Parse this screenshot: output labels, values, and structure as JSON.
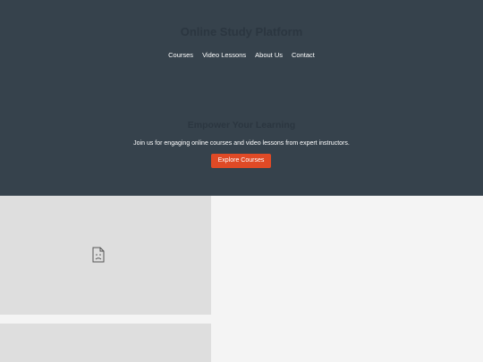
{
  "header": {
    "title": "Online Study Platform",
    "nav": [
      {
        "label": "Courses"
      },
      {
        "label": "Video Lessons"
      },
      {
        "label": "About Us"
      },
      {
        "label": "Contact"
      }
    ]
  },
  "hero": {
    "heading": "Empower Your Learning",
    "text": "Join us for engaging online courses and video lessons from expert instructors.",
    "cta_label": "Explore Courses"
  },
  "media": {
    "icon": "broken-image-icon"
  },
  "colors": {
    "hero_bg": "#36424c",
    "accent": "#e04a26",
    "page_bg": "#f4f4f4",
    "placeholder_bg": "#dedede"
  }
}
